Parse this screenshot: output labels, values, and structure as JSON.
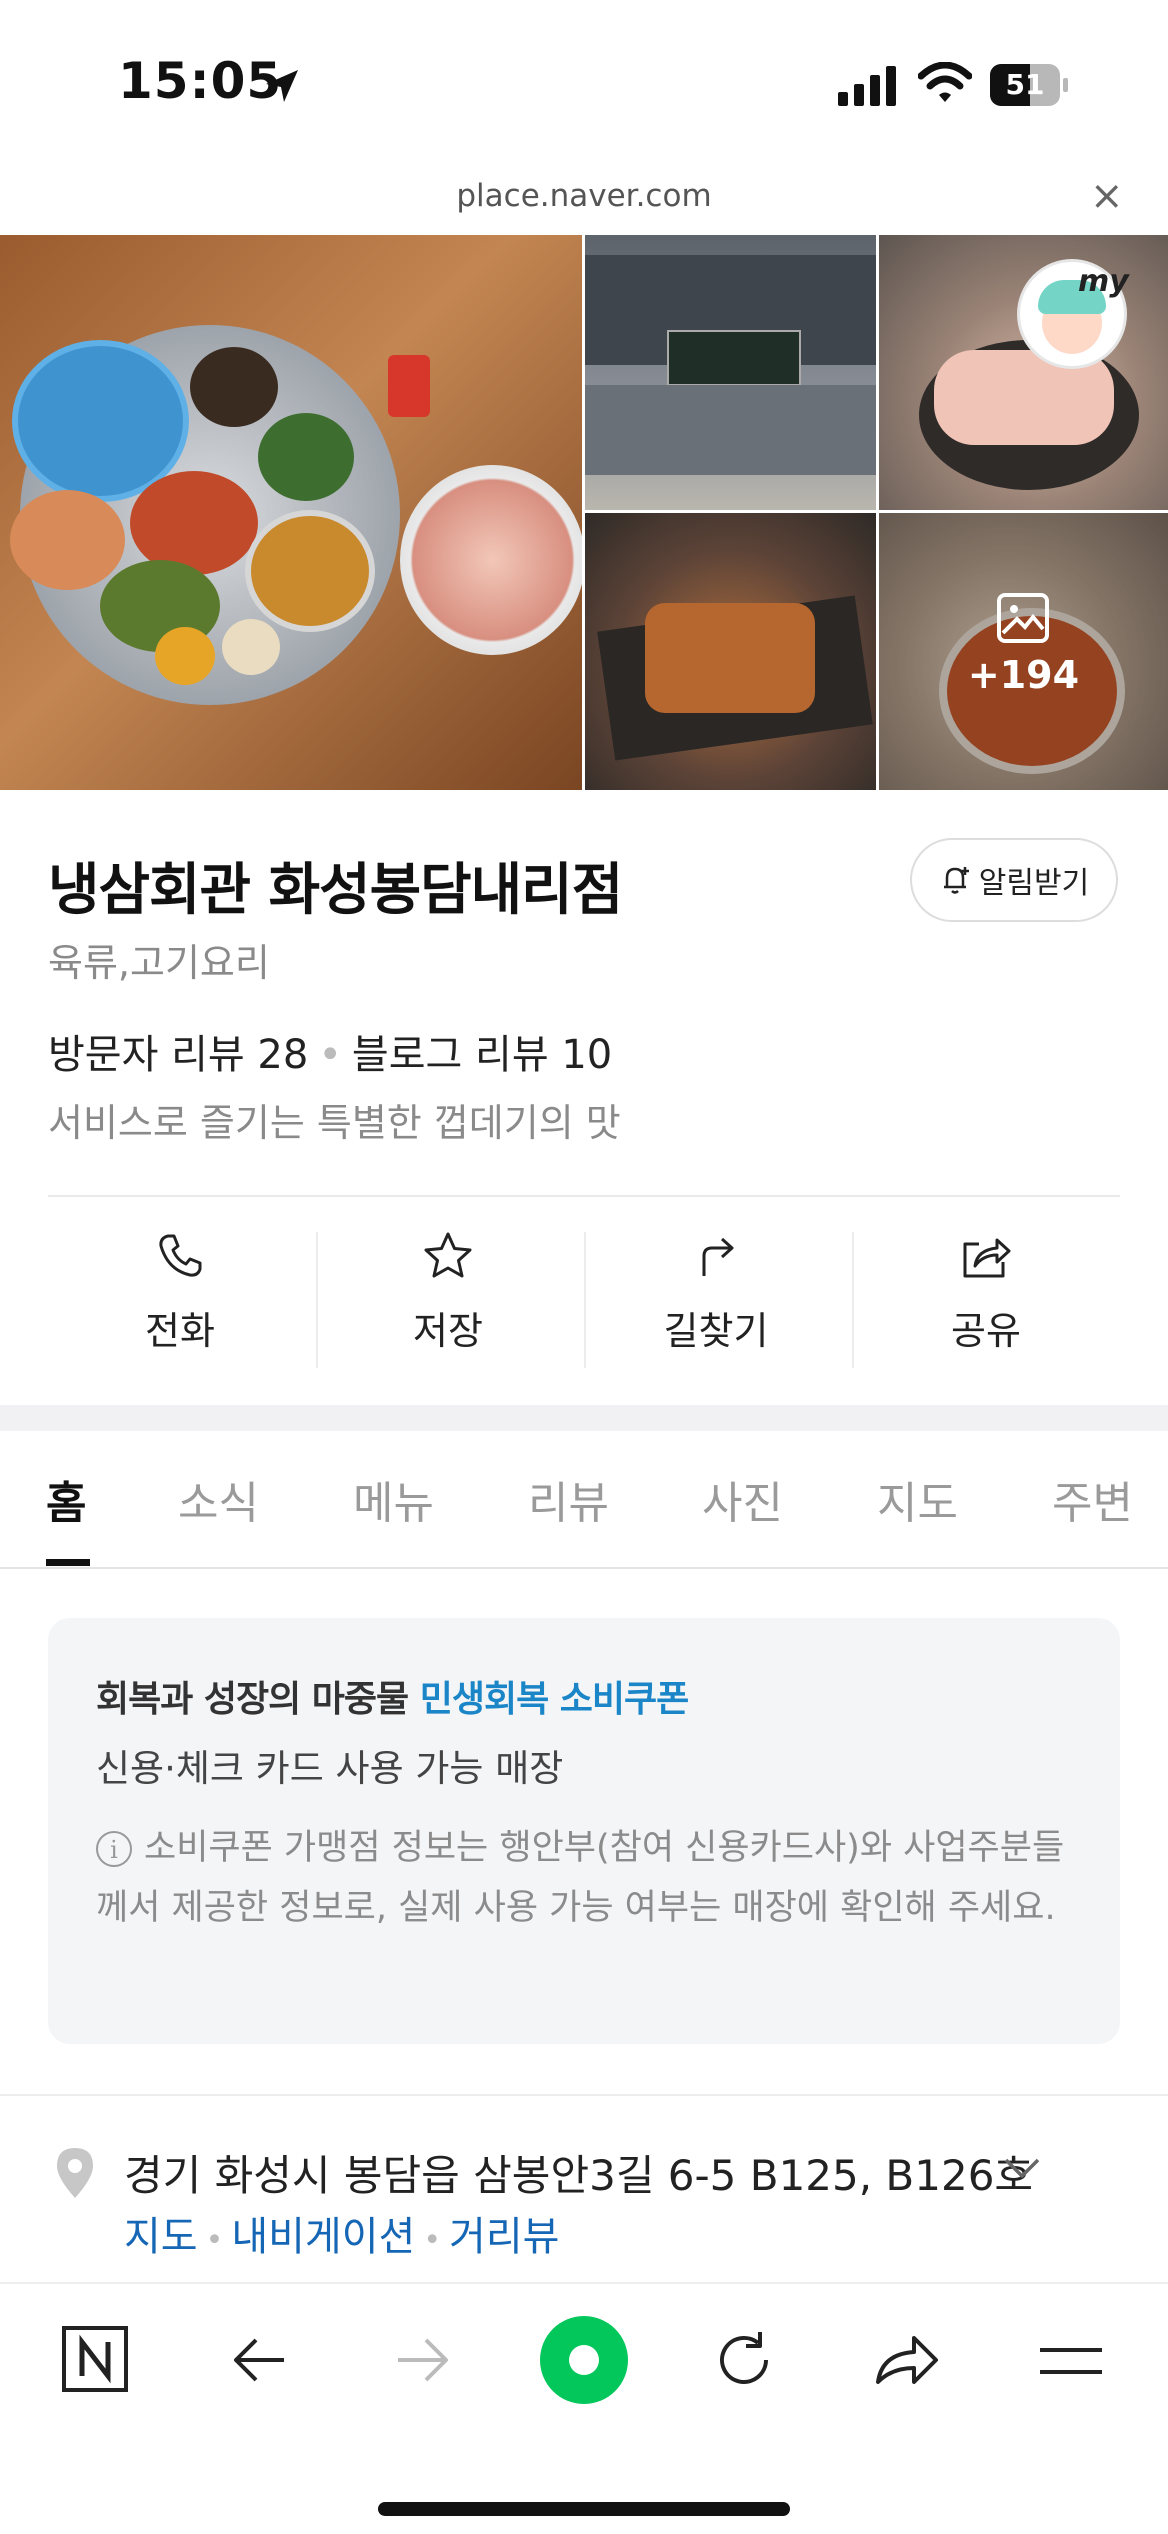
{
  "status_bar": {
    "time": "15:05",
    "battery": "51"
  },
  "browser": {
    "url": "place.naver.com",
    "close_label": "×"
  },
  "photos": {
    "more_count": "+194",
    "avatar_label": "my"
  },
  "place": {
    "name": "냉삼회관 화성봉담내리점",
    "category": "육류,고기요리",
    "visitor_reviews": "방문자 리뷰 28",
    "blog_reviews": "블로그 리뷰 10",
    "description": "서비스로 즐기는 특별한 껍데기의 맛",
    "alarm_label": "알림받기"
  },
  "actions": [
    {
      "label": "전화",
      "icon": "phone-icon"
    },
    {
      "label": "저장",
      "icon": "star-icon"
    },
    {
      "label": "길찾기",
      "icon": "directions-icon"
    },
    {
      "label": "공유",
      "icon": "share-icon"
    }
  ],
  "tabs": [
    {
      "label": "홈",
      "active": true
    },
    {
      "label": "소식"
    },
    {
      "label": "메뉴"
    },
    {
      "label": "리뷰"
    },
    {
      "label": "사진"
    },
    {
      "label": "지도"
    },
    {
      "label": "주변"
    }
  ],
  "coupon": {
    "title_prefix": "회복과 성장의 마중물",
    "title_highlight": "민생회복 소비쿠폰",
    "subtitle": "신용·체크 카드 사용 가능 매장",
    "note": "소비쿠폰 가맹점 정보는 행안부(참여 신용카드사)와 사업주분들께서 제공한 정보로, 실제 사용 가능 여부는 매장에 확인해 주세요.",
    "info_glyph": "i"
  },
  "address": {
    "text": "경기 화성시 봉담읍 삼봉안3길 6-5 B125, B126호",
    "links": [
      "지도",
      "내비게이션",
      "거리뷰"
    ]
  },
  "colors": {
    "accent_blue": "#1a86c8",
    "link_blue": "#1566b4",
    "naver_green": "#03c75a"
  },
  "toolbar": {
    "buttons": [
      "naver-home-icon",
      "back-arrow-icon",
      "forward-arrow-icon",
      "green-dot-button",
      "refresh-icon",
      "share-icon",
      "menu-icon"
    ]
  }
}
